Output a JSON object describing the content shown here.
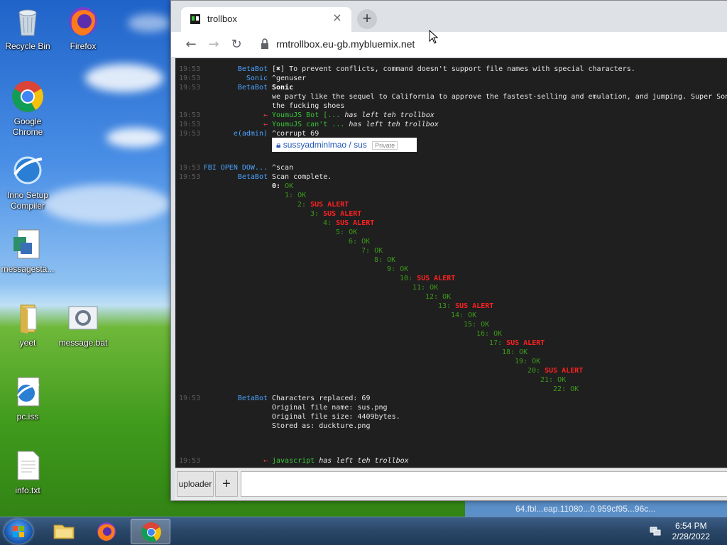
{
  "desktop": {
    "icons": [
      {
        "label": "Recycle Bin"
      },
      {
        "label": "Firefox"
      },
      {
        "label": "Google Chrome"
      },
      {
        "label": "Inno Setup Compiler"
      },
      {
        "label": "messagesta..."
      },
      {
        "label": "yeet"
      },
      {
        "label": "message.bat"
      },
      {
        "label": "pc.iss"
      },
      {
        "label": "info.txt"
      }
    ]
  },
  "browser": {
    "tab_title": "trollbox",
    "url": "rmtrollbox.eu-gb.mybluemix.net",
    "icons": {
      "back": "arrow-left-icon",
      "forward": "arrow-right-icon",
      "reload": "reload-icon",
      "lock": "lock-icon"
    }
  },
  "chat": {
    "lines": [
      {
        "ts": "19:53",
        "nick": "BetaBot",
        "text": "[✖] To prevent conflicts, command doesn't support file names with special characters."
      },
      {
        "ts": "19:53",
        "nick": "Sonic",
        "text": "^genuser"
      },
      {
        "ts": "19:53",
        "nick": "BetaBot",
        "text": "Sonic"
      },
      {
        "ts": "",
        "nick": "",
        "text": "we party like the sequel to California to approve the fastest-selling and emulation, and jumping. Super Sonic"
      },
      {
        "ts": "",
        "nick": "",
        "text": "the fucking shoes"
      },
      {
        "ts": "19:53",
        "nick": "←",
        "text_user": "YoumuJS Bot [...",
        "text": "has left teh trollbox"
      },
      {
        "ts": "19:53",
        "nick": "←",
        "text_user": "YoumuJS can't ...",
        "text": "has left teh trollbox"
      },
      {
        "ts": "19:53",
        "nick": "e(admin)",
        "text": "^corrupt 69"
      },
      {
        "ts": "19:53",
        "nick": "FBI OPEN DOW...",
        "text": "^scan"
      },
      {
        "ts": "19:53",
        "nick": "BetaBot",
        "text": "Scan complete."
      },
      {
        "ts": "19:53",
        "nick": "BetaBot",
        "text": "Characters replaced: 69"
      },
      {
        "ts": "",
        "nick": "",
        "text": "Original file name: sus.png"
      },
      {
        "ts": "",
        "nick": "",
        "text": "Original file size: 4409bytes."
      },
      {
        "ts": "",
        "nick": "",
        "text": "Stored as: duckture.png"
      },
      {
        "ts": "19:53",
        "nick": "←",
        "text_user": "javascript",
        "text": "has left teh trollbox"
      }
    ],
    "link_card": {
      "path": "sussyadminlmao / sus",
      "badge": "Private"
    },
    "scan_results": [
      {
        "n": "0:",
        "status": "OK"
      },
      {
        "n": "1:",
        "status": "OK"
      },
      {
        "n": "2:",
        "status": "SUS ALERT"
      },
      {
        "n": "3:",
        "status": "SUS ALERT"
      },
      {
        "n": "4:",
        "status": "SUS ALERT"
      },
      {
        "n": "5:",
        "status": "OK"
      },
      {
        "n": "6:",
        "status": "OK"
      },
      {
        "n": "7:",
        "status": "OK"
      },
      {
        "n": "8:",
        "status": "OK"
      },
      {
        "n": "9:",
        "status": "OK"
      },
      {
        "n": "10:",
        "status": "SUS ALERT"
      },
      {
        "n": "11:",
        "status": "OK"
      },
      {
        "n": "12:",
        "status": "OK"
      },
      {
        "n": "13:",
        "status": "SUS ALERT"
      },
      {
        "n": "14:",
        "status": "OK"
      },
      {
        "n": "15:",
        "status": "OK"
      },
      {
        "n": "16:",
        "status": "OK"
      },
      {
        "n": "17:",
        "status": "SUS ALERT"
      },
      {
        "n": "18:",
        "status": "OK"
      },
      {
        "n": "19:",
        "status": "OK"
      },
      {
        "n": "20:",
        "status": "SUS ALERT"
      },
      {
        "n": "21:",
        "status": "OK"
      },
      {
        "n": "22:",
        "status": "OK"
      }
    ],
    "uploader_label": "uploader",
    "plus_label": "+"
  },
  "background_window_text": "64.fbl...eap.11080...0.959cf95...96c...",
  "taskbar": {
    "time": "6:54 PM",
    "date": "2/28/2022"
  }
}
